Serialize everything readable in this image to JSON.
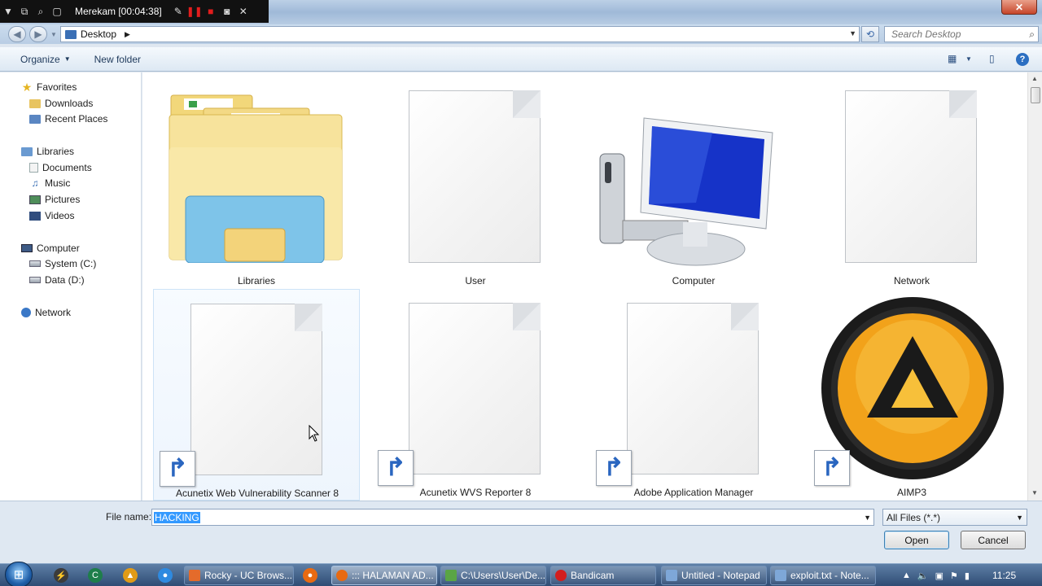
{
  "recorder": {
    "status": "Merekam [00:04:38]"
  },
  "address": {
    "breadcrumb": "Desktop",
    "search_placeholder": "Search Desktop"
  },
  "toolbar": {
    "organize_label": "Organize",
    "new_folder_label": "New folder"
  },
  "nav": {
    "favorites": "Favorites",
    "downloads": "Downloads",
    "recent_places": "Recent Places",
    "libraries": "Libraries",
    "documents": "Documents",
    "music": "Music",
    "pictures": "Pictures",
    "videos": "Videos",
    "computer": "Computer",
    "system_c": "System (C:)",
    "data_d": "Data (D:)",
    "network": "Network"
  },
  "files": [
    {
      "name": "Libraries",
      "icon": "libraries-icon"
    },
    {
      "name": "User",
      "icon": "document-icon"
    },
    {
      "name": "Computer",
      "icon": "computer-icon"
    },
    {
      "name": "Network",
      "icon": "document-icon"
    },
    {
      "name": "Acunetix Web Vulnerability Scanner 8",
      "icon": "shortcut-document-icon"
    },
    {
      "name": "Acunetix WVS Reporter 8",
      "icon": "shortcut-document-icon"
    },
    {
      "name": "Adobe Application Manager",
      "icon": "shortcut-document-icon"
    },
    {
      "name": "AIMP3",
      "icon": "aimp-icon"
    }
  ],
  "bottom": {
    "file_name_label": "File name:",
    "file_name_value": "HACKING",
    "file_type": "All Files (*.*)",
    "open_label": "Open",
    "cancel_label": "Cancel"
  },
  "taskbar": {
    "tasks": [
      {
        "label": "Rocky - UC Brows...",
        "color": "#e46b2b"
      },
      {
        "label": "::: HALAMAN AD...",
        "color": "#e86a12"
      },
      {
        "label": "C:\\Users\\User\\De...",
        "color": "#5aa545"
      },
      {
        "label": "Bandicam",
        "color": "#d21e1e"
      },
      {
        "label": "Untitled - Notepad",
        "color": "#7ea7d8"
      },
      {
        "label": "exploit.txt - Note...",
        "color": "#7ea7d8"
      }
    ],
    "clock": "11:25"
  }
}
